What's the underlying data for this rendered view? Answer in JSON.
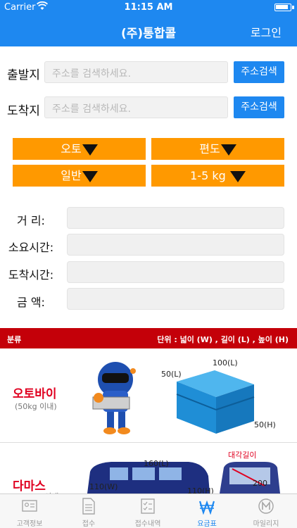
{
  "status": {
    "carrier": "Carrier",
    "time": "11:15 AM"
  },
  "nav": {
    "title": "(주)통합콜",
    "login": "로그인"
  },
  "address": {
    "origin_label": "출발지",
    "dest_label": "도착지",
    "placeholder": "주소를 검색하세요.",
    "search_btn": "주소검색"
  },
  "options": {
    "vehicle": "오토",
    "trip": "편도",
    "service": "일반",
    "weight": "1-5 kg"
  },
  "info": {
    "distance_label": "거 리:",
    "duration_label": "소요시간:",
    "arrival_label": "도착시간:",
    "amount_label": "금 액:"
  },
  "table": {
    "category": "분류",
    "unit": "단위 : 넓이 (W) , 길이 (L) , 높이 (H)"
  },
  "vehicles": [
    {
      "name": "오토바이",
      "note": "(50kg 이내)",
      "dims": [
        "50(L)",
        "100(L)",
        "50(H)"
      ]
    },
    {
      "name": "다마스",
      "note": "(400kg 이내)",
      "dims": [
        "160(L)",
        "110(W)",
        "110(H)",
        "대각길이",
        "200"
      ]
    }
  ],
  "tabs": [
    {
      "label": "고객정보",
      "icon": "customer-card-icon"
    },
    {
      "label": "접수",
      "icon": "document-icon"
    },
    {
      "label": "접수내역",
      "icon": "checklist-icon"
    },
    {
      "label": "요금표",
      "icon": "won-icon"
    },
    {
      "label": "마일리지",
      "icon": "mileage-icon"
    }
  ],
  "colors": {
    "brand_blue": "#1e88f0",
    "option_orange": "#ff9900",
    "header_red": "#c40009",
    "vehicle_red": "#e00020"
  }
}
